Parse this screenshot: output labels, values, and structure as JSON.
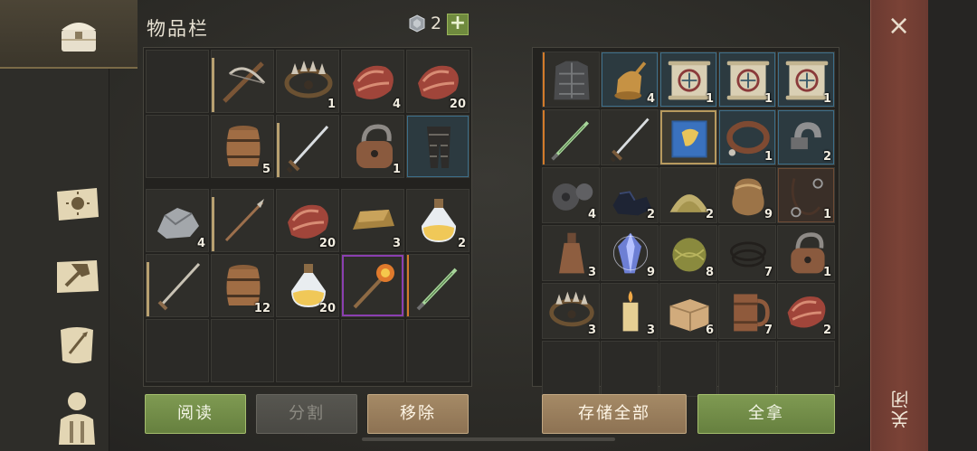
{
  "header": {
    "title": "物品栏",
    "gem_count": "2",
    "plus_label": "+"
  },
  "inventory": {
    "rows": [
      [
        {
          "icon": "empty"
        },
        {
          "icon": "crossbow-icon",
          "count": ""
        },
        {
          "icon": "bear-trap-icon",
          "count": "1"
        },
        {
          "icon": "meat-icon",
          "count": "4"
        },
        {
          "icon": "meat-icon",
          "count": "20"
        }
      ],
      [
        {
          "icon": "empty"
        },
        {
          "icon": "barrel-icon",
          "count": "5"
        },
        {
          "icon": "sword-icon",
          "count": ""
        },
        {
          "icon": "padlock-icon",
          "count": "1"
        },
        {
          "icon": "leg-armor-icon",
          "count": ""
        }
      ],
      [
        {
          "icon": "stone-icon",
          "count": "4"
        },
        {
          "icon": "spear-icon",
          "count": ""
        },
        {
          "icon": "meat-icon",
          "count": "20"
        },
        {
          "icon": "ingot-icon",
          "count": "3"
        },
        {
          "icon": "potion-icon",
          "count": "2"
        }
      ],
      [
        {
          "icon": "long-sword-icon",
          "count": ""
        },
        {
          "icon": "barrel-icon",
          "count": "12"
        },
        {
          "icon": "potion-icon",
          "count": "20"
        },
        {
          "icon": "fire-mace-icon",
          "count": ""
        },
        {
          "icon": "dagger-icon",
          "count": ""
        }
      ]
    ]
  },
  "storage": {
    "rows": [
      [
        {
          "icon": "chest-armor-icon",
          "count": ""
        },
        {
          "icon": "bell-icon",
          "count": "4"
        },
        {
          "icon": "scroll-icon",
          "count": "1"
        },
        {
          "icon": "scroll-icon",
          "count": "1"
        },
        {
          "icon": "scroll-icon",
          "count": "1"
        }
      ],
      [
        {
          "icon": "dagger-icon",
          "count": ""
        },
        {
          "icon": "sword-icon",
          "count": ""
        },
        {
          "icon": "book-icon",
          "count": ""
        },
        {
          "icon": "collar-icon",
          "count": "1"
        },
        {
          "icon": "shackle-icon",
          "count": "2"
        }
      ],
      [
        {
          "icon": "gear-icon",
          "count": "4"
        },
        {
          "icon": "coal-icon",
          "count": "2"
        },
        {
          "icon": "sand-icon",
          "count": "2"
        },
        {
          "icon": "sack-icon",
          "count": "9"
        },
        {
          "icon": "leash-icon",
          "count": "1"
        }
      ],
      [
        {
          "icon": "bottle-icon",
          "count": "3"
        },
        {
          "icon": "crystal-icon",
          "count": "9"
        },
        {
          "icon": "yarn-icon",
          "count": "8"
        },
        {
          "icon": "wire-icon",
          "count": "7"
        },
        {
          "icon": "padlock-icon",
          "count": "1"
        }
      ],
      [
        {
          "icon": "bear-trap-icon",
          "count": "3"
        },
        {
          "icon": "candle-icon",
          "count": "3"
        },
        {
          "icon": "cloth-icon",
          "count": "6"
        },
        {
          "icon": "mug-icon",
          "count": "7"
        },
        {
          "icon": "meat-icon",
          "count": "2"
        }
      ]
    ]
  },
  "buttons": {
    "read": "阅读",
    "split": "分割",
    "remove": "移除",
    "store_all": "存储全部",
    "take_all": "全拿"
  },
  "close": {
    "x": "×",
    "label": "关闭"
  },
  "colors": {
    "green": "#7f9a52",
    "close_bar": "#6b3a31",
    "rarity_blue": "#3c6e8a",
    "rarity_orange": "#d37b2a",
    "rarity_purple": "#8b3fb0"
  }
}
